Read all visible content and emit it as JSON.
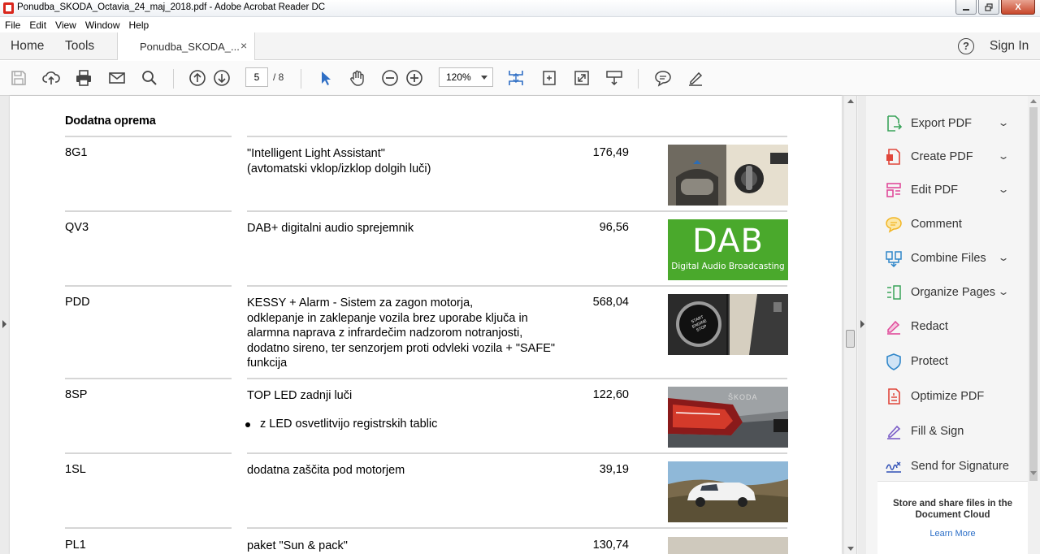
{
  "window": {
    "title": "Ponudba_SKODA_Octavia_24_maj_2018.pdf - Adobe Acrobat Reader DC",
    "min_icon": "minimize-icon",
    "max_icon": "maximize-icon",
    "close_label": "X"
  },
  "menu": [
    "File",
    "Edit",
    "View",
    "Window",
    "Help"
  ],
  "tabs": {
    "home": "Home",
    "tools": "Tools",
    "document": "Ponudba_SKODA_...",
    "close": "×",
    "help": "?",
    "sign_in": "Sign In"
  },
  "toolbar": {
    "current_page": "5",
    "total_pages": "/ 8",
    "zoom": "120%"
  },
  "document": {
    "section_title": "Dodatna oprema",
    "rows": [
      {
        "code": "8G1",
        "description": "\"Intelligent Light Assistant\"\n(avtomatski vklop/izklop dolgih luči)",
        "price": "176,49"
      },
      {
        "code": "QV3",
        "description": "DAB+ digitalni audio sprejemnik",
        "price": "96,56",
        "image_text": "DAB",
        "image_caption": "Digital Audio Broadcasting"
      },
      {
        "code": "PDD",
        "description": "KESSY + Alarm - Sistem za zagon motorja,\nodklepanje in zaklepanje vozila brez uporabe ključa in\nalarmna naprava z infrardečim nadzorom notranjosti,\ndodatno sireno, ter senzorjem proti odvleki vozila + \"SAFE\"\nfunkcija",
        "price": "568,04",
        "image_text": "START ENGINE STOP"
      },
      {
        "code": "8SP",
        "description": "TOP LED zadnji luči",
        "price": "122,60",
        "bullet": "z LED osvetlitvijo registrskih tablic",
        "image_text": "ŠKODA"
      },
      {
        "code": "1SL",
        "description": "dodatna zaščita pod motorjem",
        "price": "39,19"
      },
      {
        "code": "PL1",
        "description": "paket \"Sun & pack\"",
        "price": "130,74"
      }
    ]
  },
  "tools_pane": {
    "items": [
      {
        "label": "Export PDF",
        "icon": "export-pdf-icon",
        "color": "#3aa35a",
        "expandable": true
      },
      {
        "label": "Create PDF",
        "icon": "create-pdf-icon",
        "color": "#e0463b",
        "expandable": true
      },
      {
        "label": "Edit PDF",
        "icon": "edit-pdf-icon",
        "color": "#e04a9a",
        "expandable": true
      },
      {
        "label": "Comment",
        "icon": "comment-icon",
        "color": "#f2b522",
        "expandable": false
      },
      {
        "label": "Combine Files",
        "icon": "combine-files-icon",
        "color": "#2f86c9",
        "expandable": true
      },
      {
        "label": "Organize Pages",
        "icon": "organize-pages-icon",
        "color": "#3aa35a",
        "expandable": true
      },
      {
        "label": "Redact",
        "icon": "redact-icon",
        "color": "#e04a9a",
        "expandable": false
      },
      {
        "label": "Protect",
        "icon": "protect-icon",
        "color": "#2f86c9",
        "expandable": false
      },
      {
        "label": "Optimize PDF",
        "icon": "optimize-pdf-icon",
        "color": "#e0463b",
        "expandable": false
      },
      {
        "label": "Fill & Sign",
        "icon": "fill-sign-icon",
        "color": "#7a5cc7",
        "expandable": false
      },
      {
        "label": "Send for Signature",
        "icon": "send-signature-icon",
        "color": "#2f4fb5",
        "expandable": false
      }
    ],
    "cloud_text": "Store and share files in the Document Cloud",
    "cloud_link": "Learn More"
  }
}
